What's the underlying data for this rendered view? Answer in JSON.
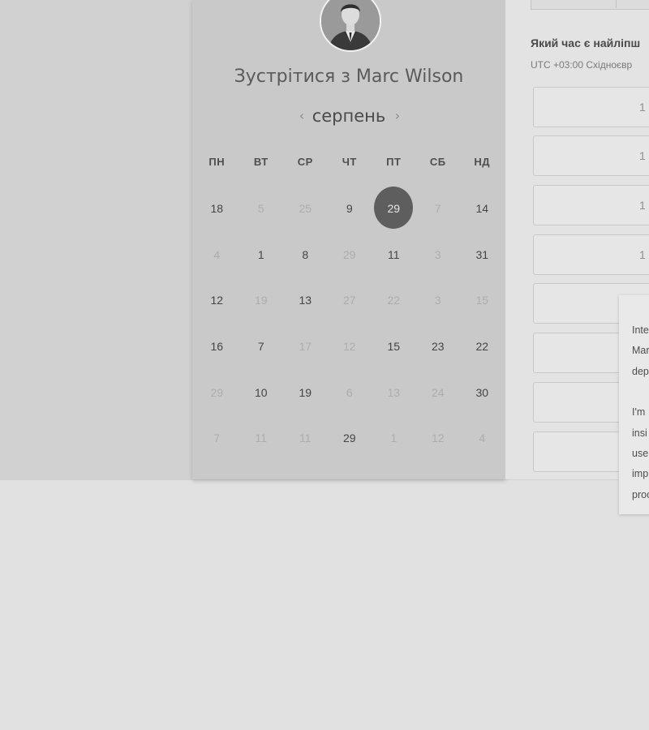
{
  "booking": {
    "title": "Зустрітися з Marc Wilson",
    "month": "серпень",
    "prev_icon": "chevron-left-icon",
    "next_icon": "chevron-right-icon",
    "weekdays": [
      "ПН",
      "ВТ",
      "СР",
      "ЧТ",
      "ПТ",
      "СБ",
      "НД"
    ],
    "weeks": [
      [
        {
          "d": "18",
          "a": true
        },
        {
          "d": "5",
          "a": false
        },
        {
          "d": "25",
          "a": false
        },
        {
          "d": "9",
          "a": true
        },
        {
          "d": "29",
          "a": true,
          "sel": true
        },
        {
          "d": "7",
          "a": false
        },
        {
          "d": "14",
          "a": true
        }
      ],
      [
        {
          "d": "4",
          "a": false
        },
        {
          "d": "1",
          "a": true
        },
        {
          "d": "8",
          "a": true
        },
        {
          "d": "29",
          "a": false
        },
        {
          "d": "11",
          "a": true
        },
        {
          "d": "3",
          "a": false
        },
        {
          "d": "31",
          "a": true
        }
      ],
      [
        {
          "d": "12",
          "a": true
        },
        {
          "d": "19",
          "a": false
        },
        {
          "d": "13",
          "a": true
        },
        {
          "d": "27",
          "a": false
        },
        {
          "d": "22",
          "a": false
        },
        {
          "d": "3",
          "a": false
        },
        {
          "d": "15",
          "a": false
        }
      ],
      [
        {
          "d": "16",
          "a": true
        },
        {
          "d": "7",
          "a": true
        },
        {
          "d": "17",
          "a": false
        },
        {
          "d": "12",
          "a": false
        },
        {
          "d": "15",
          "a": true
        },
        {
          "d": "23",
          "a": true
        },
        {
          "d": "22",
          "a": true
        }
      ],
      [
        {
          "d": "29",
          "a": false
        },
        {
          "d": "10",
          "a": true
        },
        {
          "d": "19",
          "a": true
        },
        {
          "d": "6",
          "a": false
        },
        {
          "d": "13",
          "a": false
        },
        {
          "d": "24",
          "a": false
        },
        {
          "d": "30",
          "a": true
        }
      ],
      [
        {
          "d": "7",
          "a": false
        },
        {
          "d": "11",
          "a": false
        },
        {
          "d": "11",
          "a": false
        },
        {
          "d": "29",
          "a": true
        },
        {
          "d": "1",
          "a": false
        },
        {
          "d": "12",
          "a": false
        },
        {
          "d": "4",
          "a": false
        }
      ]
    ]
  },
  "times": {
    "heading": "Який час є найліпш",
    "timezone": "UTC +03:00 Східноєвр",
    "slots": [
      "1",
      "1",
      "1",
      "1",
      "",
      "",
      "",
      ""
    ]
  },
  "tooltip": {
    "lines": [
      "Inte",
      "Mar",
      "dep",
      "I'm",
      "insi",
      "use",
      "imp",
      "proc"
    ]
  },
  "colors": {
    "selected_day": "#5e5e5e",
    "panel": "#c9c9c9",
    "page": "#e1e1e1"
  }
}
